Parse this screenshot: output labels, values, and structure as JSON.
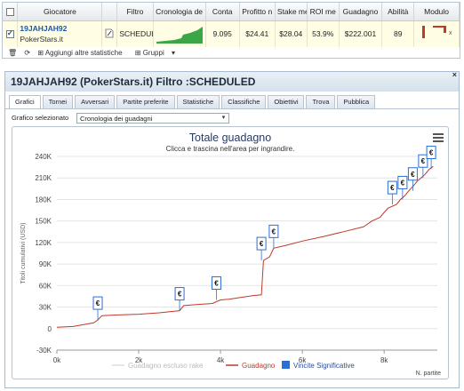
{
  "table": {
    "headers": [
      "Giocatore",
      "Filtro",
      "Cronologia de",
      "Conta",
      "Profitto n",
      "Stake me",
      "ROI me",
      "Guadagno",
      "Abilità",
      "Modulo"
    ],
    "row": {
      "player_name": "19JAHJAH92",
      "player_site": "PokerStars.it",
      "filter": "SCHEDUL",
      "count": "9.095",
      "avg_profit": "$24.41",
      "avg_stake": "$28.04",
      "avg_roi": "53.9%",
      "profit": "$222.001",
      "ability": "89"
    }
  },
  "toolbar": {
    "add_stats": "Aggiungi altre statistiche",
    "groups": "Gruppi"
  },
  "panel": {
    "title": "19JAHJAH92 (PokerStars.it) Filtro :SCHEDULED",
    "close": "×",
    "tabs": [
      "Grafici",
      "Tornei",
      "Avversari",
      "Partite preferite",
      "Statistiche",
      "Classifiche",
      "Obiettivi",
      "Trova",
      "Pubblica"
    ],
    "active_tab": "Grafici",
    "select_label": "Grafico selezionato",
    "select_value": "Cronologia dei guadagni"
  },
  "chart_data": {
    "type": "line",
    "title": "Totale guadagno",
    "subtitle": "Clicca e trascina nell'area per ingrandire.",
    "ylabel": "Titoli cumulativi (USD)",
    "xlabel": "N. partite",
    "ylim": [
      -30000,
      240000
    ],
    "xlim": [
      0,
      9300
    ],
    "y_ticks": [
      "240K",
      "210K",
      "180K",
      "150K",
      "120K",
      "90K",
      "60K",
      "30K",
      "0",
      "-30K"
    ],
    "y_tick_values": [
      240000,
      210000,
      180000,
      150000,
      120000,
      90000,
      60000,
      30000,
      0,
      -30000
    ],
    "x_ticks": [
      "0k",
      "2k",
      "4k",
      "6k",
      "8k"
    ],
    "x_tick_values": [
      0,
      2000,
      4000,
      6000,
      8000
    ],
    "legend": [
      {
        "name": "Guadagno escluso rake",
        "color": "#dcdcdc"
      },
      {
        "name": "Guadagno",
        "color": "#c0392b"
      },
      {
        "name": "Vincite Significative",
        "color": "#2a6fd1"
      }
    ],
    "series": [
      {
        "name": "Guadagno",
        "color": "#c0392b",
        "x": [
          0,
          400,
          900,
          1000,
          1100,
          1500,
          2000,
          2500,
          3000,
          3100,
          3300,
          3800,
          4000,
          4200,
          4800,
          5000,
          5050,
          5200,
          5300,
          5600,
          6000,
          6500,
          7000,
          7500,
          7700,
          7900,
          8000,
          8100,
          8300,
          8400,
          8500,
          8600,
          8700,
          8800,
          8900,
          9000,
          9100,
          9200
        ],
        "y": [
          2000,
          3000,
          8000,
          12000,
          18000,
          19000,
          20000,
          22000,
          25000,
          32000,
          33000,
          35000,
          40000,
          41000,
          46000,
          47000,
          95000,
          100000,
          112000,
          116000,
          122000,
          128000,
          135000,
          142000,
          150000,
          155000,
          162000,
          168000,
          173000,
          180000,
          185000,
          192000,
          198000,
          205000,
          210000,
          215000,
          222000,
          226000
        ]
      }
    ],
    "markers": [
      {
        "x": 1000,
        "y": 12000,
        "label": "€"
      },
      {
        "x": 3000,
        "y": 25000,
        "label": "€"
      },
      {
        "x": 3900,
        "y": 40000,
        "label": "€"
      },
      {
        "x": 5000,
        "y": 95000,
        "label": "€"
      },
      {
        "x": 5300,
        "y": 112000,
        "label": "€"
      },
      {
        "x": 8200,
        "y": 173000,
        "label": "€"
      },
      {
        "x": 8450,
        "y": 180000,
        "label": "€"
      },
      {
        "x": 8700,
        "y": 192000,
        "label": "€"
      },
      {
        "x": 8950,
        "y": 210000,
        "label": "€"
      },
      {
        "x": 9150,
        "y": 222000,
        "label": "€"
      }
    ]
  }
}
